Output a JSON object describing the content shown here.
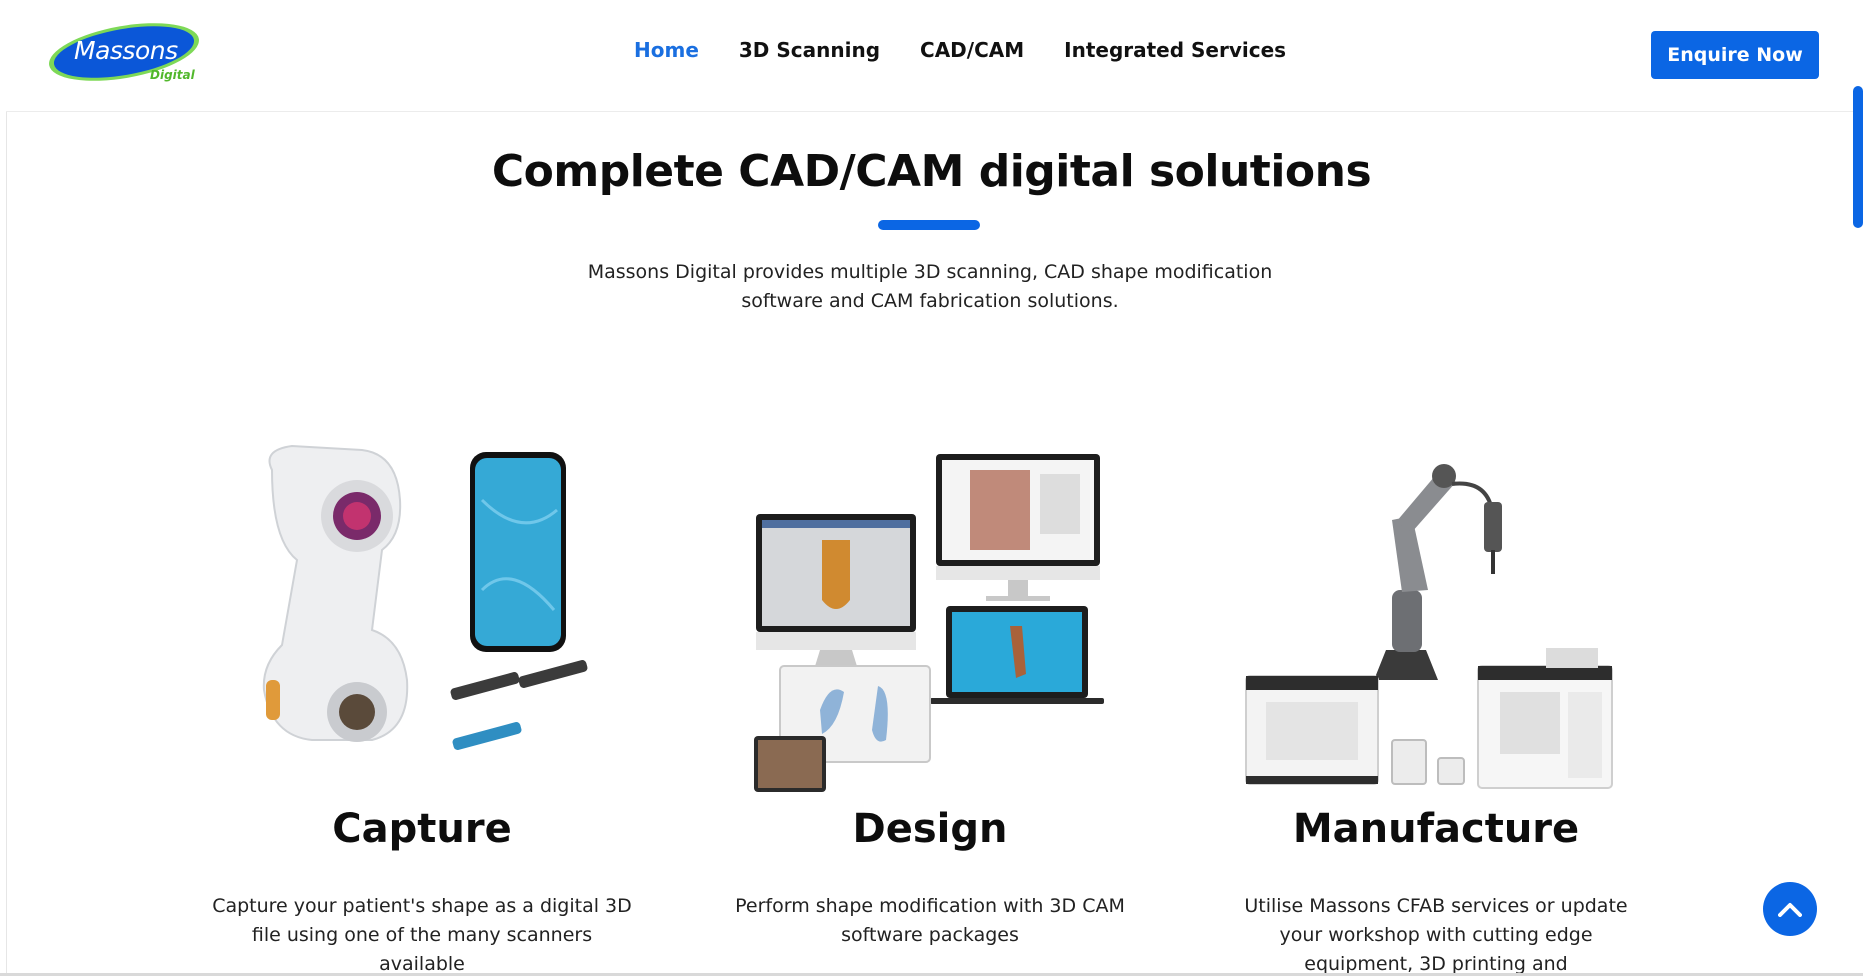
{
  "header": {
    "logo": {
      "name": "Massons",
      "sub": "Digital"
    },
    "nav": [
      {
        "label": "Home",
        "active": true
      },
      {
        "label": "3D Scanning",
        "active": false
      },
      {
        "label": "CAD/CAM",
        "active": false
      },
      {
        "label": "Integrated Services",
        "active": false
      }
    ],
    "cta_label": "Enquire Now"
  },
  "hero": {
    "title": "Complete CAD/CAM digital solutions",
    "subtitle": "Massons Digital provides multiple 3D scanning, CAD shape modification software and CAM fabrication solutions."
  },
  "columns": [
    {
      "title": "Capture",
      "description": "Capture your patient's shape as a digital 3D file using one of the many scanners available"
    },
    {
      "title": "Design",
      "description": "Perform shape modification with 3D CAM software packages"
    },
    {
      "title": "Manufacture",
      "description": "Utilise Massons CFAB services or update your workshop with cutting edge equipment, 3D printing and"
    }
  ],
  "colors": {
    "accent": "#0b66e4",
    "nav_active": "#1a6fe0",
    "logo_green": "#52b82c"
  },
  "icons": {
    "scroll_top": "chevron-up-icon"
  }
}
